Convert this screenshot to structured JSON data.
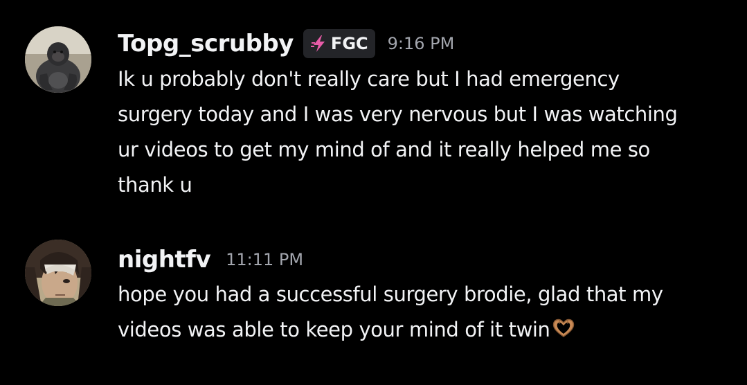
{
  "messages": [
    {
      "username": "Topg_scrubby",
      "tag": {
        "icon": "lightning-bolt-icon",
        "label": "FGC",
        "icon_color": "#e85ca8"
      },
      "timestamp": "9:16 PM",
      "avatar": "gorilla-avatar",
      "lines": [
        "Ik u probably don't really care but I had emergency",
        "surgery today and I was very nervous but I was watching",
        "ur videos to get my mind of and it really helped me so",
        "thank u"
      ]
    },
    {
      "username": "nightfv",
      "timestamp": "11:11 PM",
      "avatar": "anime-character-avatar",
      "lines": [
        "hope you had a successful surgery brodie, glad that my",
        "videos was able to keep your mind of it twin"
      ],
      "emoji": "heart-hands-emoji"
    }
  ],
  "colors": {
    "background": "#000000",
    "username": "#f2f3f5",
    "timestamp": "#a3a6ae",
    "tag_background": "#232428"
  }
}
